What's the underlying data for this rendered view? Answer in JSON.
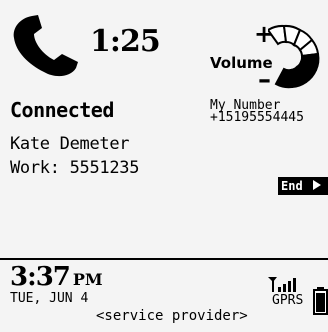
{
  "call": {
    "timer": "1:25",
    "status": "Connected",
    "contact_name": "Kate Demeter",
    "contact_number": "Work: 5551235",
    "end_label": "End"
  },
  "volume": {
    "label": "Volume",
    "plus": "+",
    "minus": "–"
  },
  "my_number": {
    "label": "My Number",
    "value": "+15195554445"
  },
  "status_bar": {
    "time": "3:37",
    "ampm": "PM",
    "date": "TUE, JUN 4",
    "provider": "<service provider>",
    "network": "GPRS"
  },
  "icons": {
    "handset": "phone-handset-icon",
    "volume_dial": "volume-dial-icon",
    "signal": "signal-strength-icon",
    "battery": "battery-icon",
    "end_arrow": "triangle-right-icon"
  },
  "colors": {
    "background": "#f4f4f4",
    "foreground": "#000000"
  }
}
